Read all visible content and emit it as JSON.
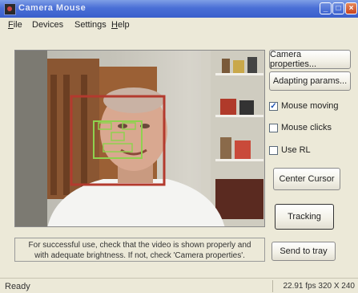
{
  "window": {
    "title": "Camera Mouse"
  },
  "menu": {
    "items": [
      {
        "label": "File",
        "mn": "F",
        "rest": "ile"
      },
      {
        "label": "Devices",
        "mn": "",
        "rest": "Devices"
      },
      {
        "label": "Settings",
        "mn": "",
        "rest": "Settings"
      },
      {
        "label": "Help",
        "mn": "H",
        "rest": "elp"
      }
    ]
  },
  "buttons": {
    "camera_properties": "Camera properties...",
    "adapting_params": "Adapting params...",
    "center_cursor": "Center Cursor",
    "tracking": "Tracking",
    "send_to_tray": "Send to tray"
  },
  "checkboxes": [
    {
      "label": "Mouse moving",
      "checked": true
    },
    {
      "label": "Mouse clicks",
      "checked": false
    },
    {
      "label": "Use RL",
      "checked": false
    }
  ],
  "info_text": {
    "line1": "For successful use, check that the video is shown properly and",
    "line2": "with adequate brightness. If not, check 'Camera properties'."
  },
  "status": {
    "left": "Ready",
    "right": "22.91 fps 320 X 240"
  },
  "colors": {
    "face_box": "#b33a2e",
    "feature_box": "#8fd14f",
    "titlebar": "#3a5fcc"
  }
}
